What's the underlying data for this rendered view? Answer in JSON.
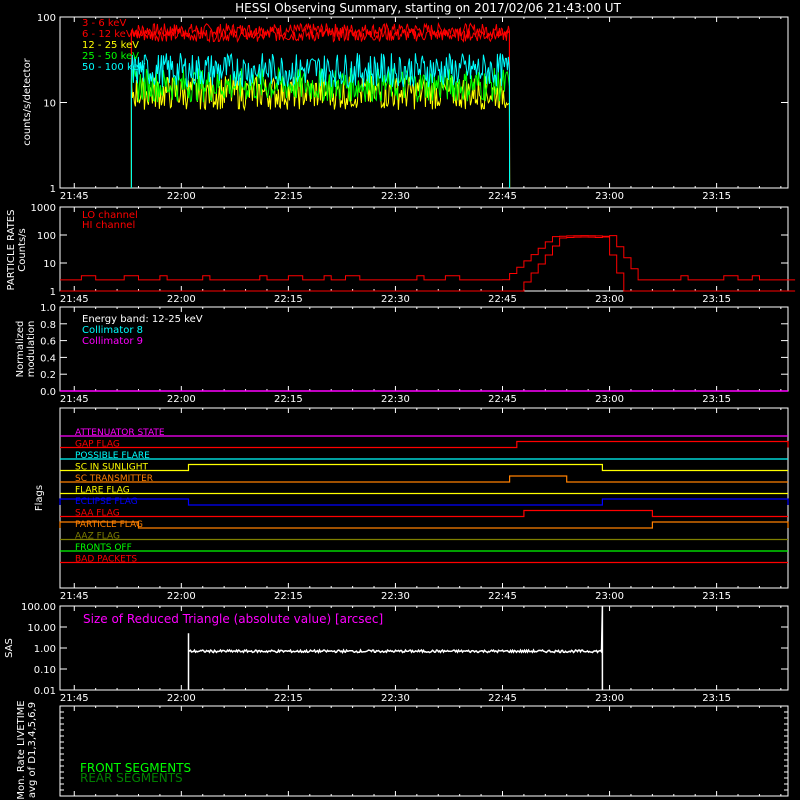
{
  "title": "HESSI Observing Summary, starting on 2017/02/06 21:43:00 UT",
  "time_ticks": [
    "21:45",
    "22:00",
    "22:15",
    "22:30",
    "22:45",
    "23:00",
    "23:15"
  ],
  "time_range_hours": [
    21.7167,
    23.4167
  ],
  "chart_data": [
    {
      "type": "line",
      "id": "count-rates",
      "ylabel": "counts/s/detector",
      "yscale": "log",
      "ylim": [
        1,
        100
      ],
      "yticks": [
        "1",
        "10",
        "100"
      ],
      "data_window": [
        "21:53",
        "22:46"
      ],
      "series": [
        {
          "name": "3 - 6 keV",
          "color": "#ff0000",
          "level": 70,
          "noise": 0.04
        },
        {
          "name": "6 - 12 keV",
          "color": "#ff0000",
          "level": 62,
          "noise": 0.04
        },
        {
          "name": "12 - 25 keV",
          "color": "#ffff00",
          "level": 13,
          "noise": 0.1
        },
        {
          "name": "25 - 50 keV",
          "color": "#00ff00",
          "level": 16,
          "noise": 0.1
        },
        {
          "name": "50 - 100 keV",
          "color": "#00ffff",
          "level": 24,
          "noise": 0.1
        }
      ]
    },
    {
      "type": "line",
      "id": "particle-rates",
      "ylabel": "PARTICLE RATES",
      "ylabel2": "Counts/s",
      "yscale": "log",
      "ylim": [
        1,
        1000
      ],
      "yticks": [
        "1",
        "10",
        "100",
        "1000"
      ],
      "series": [
        {
          "name": "LO channel",
          "color": "#ff0000",
          "baseline": 2.5,
          "peak": 95,
          "rise": [
            "22:45",
            "22:52"
          ],
          "fall": [
            "23:00",
            "23:04"
          ]
        },
        {
          "name": "HI channel",
          "color": "#ff0000",
          "baseline": 1,
          "peak": 85,
          "rise": [
            "22:47",
            "22:53"
          ],
          "fall": [
            "22:59",
            "23:02"
          ]
        }
      ]
    },
    {
      "type": "line",
      "id": "modulation",
      "ylabel": "Normalized",
      "ylabel2": "modulation",
      "ylim": [
        0,
        1
      ],
      "yticks": [
        "0.0",
        "0.2",
        "0.4",
        "0.6",
        "0.8",
        "1.0"
      ],
      "annotation": "Energy band: 12-25 keV",
      "series": [
        {
          "name": "Collimator 8",
          "color": "#00ffff",
          "values": []
        },
        {
          "name": "Collimator 9",
          "color": "#ff00ff",
          "values": [
            0,
            0
          ]
        }
      ]
    },
    {
      "type": "step",
      "id": "flags",
      "ylabel": "Flags",
      "flags": [
        {
          "name": "ATTENUATOR STATE",
          "color": "#ff00ff",
          "segments": []
        },
        {
          "name": "GAP FLAG",
          "color": "#ff0000",
          "segments": [
            [
              "22:47",
              "23:25"
            ]
          ]
        },
        {
          "name": "POSSIBLE FLARE",
          "color": "#00ffff",
          "segments": []
        },
        {
          "name": "SC IN SUNLIGHT",
          "color": "#ffff00",
          "segments": [
            [
              "22:01",
              "22:59"
            ]
          ]
        },
        {
          "name": "SC TRANSMITTER",
          "color": "#ff8000",
          "segments": [
            [
              "22:46",
              "22:54"
            ]
          ]
        },
        {
          "name": "FLARE FLAG",
          "color": "#ffff00",
          "segments": []
        },
        {
          "name": "ECLIPSE FLAG",
          "color": "#0000ff",
          "segments": [
            [
              "21:43",
              "22:01"
            ],
            [
              "22:59",
              "23:25"
            ]
          ]
        },
        {
          "name": "SAA FLAG",
          "color": "#ff0000",
          "segments": [
            [
              "22:48",
              "23:06"
            ]
          ]
        },
        {
          "name": "PARTICLE FLAG",
          "color": "#ff8000",
          "segments": [
            [
              "21:43",
              "21:54"
            ],
            [
              "23:06",
              "23:25"
            ]
          ]
        },
        {
          "name": "AAZ FLAG",
          "color": "#808000",
          "segments": []
        },
        {
          "name": "FRONTS OFF",
          "color": "#00ff00",
          "segments": []
        },
        {
          "name": "BAD PACKETS",
          "color": "#ff0000",
          "segments": []
        }
      ]
    },
    {
      "type": "line",
      "id": "sas",
      "ylabel": "SAS",
      "yscale": "log",
      "ylim": [
        0.01,
        100
      ],
      "yticks": [
        "0.01",
        "0.10",
        "1.00",
        "10.00",
        "100.00"
      ],
      "annotation": "Size of Reduced Triangle (absolute value) [arcsec]",
      "series": [
        {
          "name": "reduced triangle",
          "color": "#ffffff",
          "level": 0.7,
          "window": [
            "22:01",
            "22:59"
          ]
        }
      ]
    },
    {
      "type": "line",
      "id": "livetime",
      "ylabel": "Mon. Rate LIVETIME",
      "ylabel2": "avg of D1,3,4,5,6,9",
      "series": [
        {
          "name": "FRONT SEGMENTS",
          "color": "#00ff00",
          "values": []
        },
        {
          "name": "REAR SEGMENTS",
          "color": "#008000",
          "values": []
        }
      ]
    }
  ]
}
